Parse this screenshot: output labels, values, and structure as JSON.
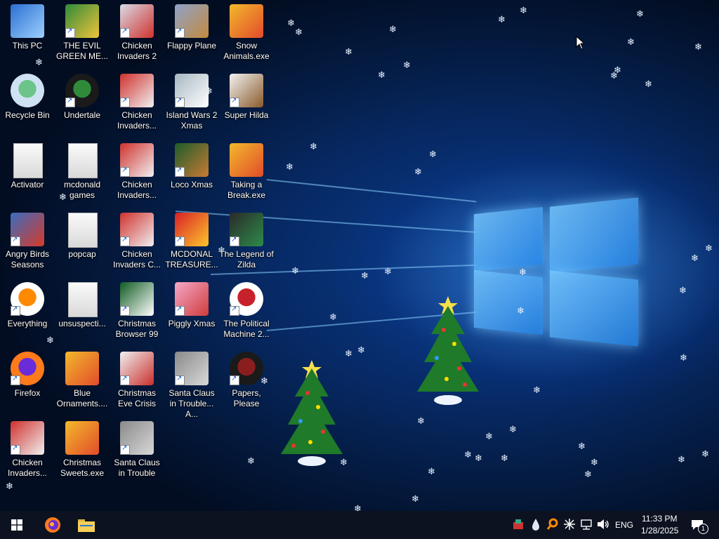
{
  "desktop": {
    "icons": [
      {
        "label": "This PC",
        "icon": "this-pc-icon",
        "shortcut": false
      },
      {
        "label": "THE EVIL GREEN ME...",
        "icon": "evil-green-men-icon",
        "shortcut": true
      },
      {
        "label": "Chicken Invaders 2",
        "icon": "chicken-invaders-2-icon",
        "shortcut": true
      },
      {
        "label": "Flappy Plane",
        "icon": "flappy-plane-icon",
        "shortcut": true
      },
      {
        "label": "Snow Animals.exe",
        "icon": "gift-box-icon",
        "shortcut": false
      },
      {
        "label": "Recycle Bin",
        "icon": "recycle-bin-icon",
        "shortcut": false
      },
      {
        "label": "Undertale",
        "icon": "undertale-icon",
        "shortcut": true
      },
      {
        "label": "Chicken Invaders...",
        "icon": "chicken-invaders-icon",
        "shortcut": true
      },
      {
        "label": "Island Wars 2 Xmas",
        "icon": "island-wars-icon",
        "shortcut": true
      },
      {
        "label": "Super Hilda",
        "icon": "super-hilda-icon",
        "shortcut": true
      },
      {
        "label": "Activator",
        "icon": "folder-icon",
        "shortcut": false
      },
      {
        "label": "mcdonald games",
        "icon": "folder-icon",
        "shortcut": false
      },
      {
        "label": "Chicken Invaders...",
        "icon": "chicken-invaders-icon",
        "shortcut": true
      },
      {
        "label": "Loco Xmas",
        "icon": "loco-xmas-icon",
        "shortcut": true
      },
      {
        "label": "Taking a Break.exe",
        "icon": "gift-box-icon",
        "shortcut": false
      },
      {
        "label": "Angry Birds Seasons",
        "icon": "angry-birds-icon",
        "shortcut": true
      },
      {
        "label": "popcap",
        "icon": "folder-icon",
        "shortcut": false
      },
      {
        "label": "Chicken Invaders C...",
        "icon": "chicken-invaders-icon",
        "shortcut": true
      },
      {
        "label": "MCDONAL TREASURE...",
        "icon": "mcdonalds-icon",
        "shortcut": true
      },
      {
        "label": "The Legend of Zilda",
        "icon": "legend-of-zilda-icon",
        "shortcut": true
      },
      {
        "label": "Everything",
        "icon": "everything-search-icon",
        "shortcut": true
      },
      {
        "label": "unsuspecti...",
        "icon": "folder-icon",
        "shortcut": false
      },
      {
        "label": "Christmas Browser 99",
        "icon": "christmas-browser-icon",
        "shortcut": true
      },
      {
        "label": "Piggly Xmas",
        "icon": "piggly-xmas-icon",
        "shortcut": true
      },
      {
        "label": "The Political Machine 2...",
        "icon": "political-machine-icon",
        "shortcut": true
      },
      {
        "label": "Firefox",
        "icon": "firefox-icon",
        "shortcut": true
      },
      {
        "label": "Blue Ornaments....",
        "icon": "gift-box-icon",
        "shortcut": false
      },
      {
        "label": "Christmas Eve Crisis",
        "icon": "santa-icon",
        "shortcut": true
      },
      {
        "label": "Santa Claus in Trouble... A...",
        "icon": "santa-claus-icon",
        "shortcut": true
      },
      {
        "label": "Papers, Please",
        "icon": "papers-please-icon",
        "shortcut": true
      },
      {
        "label": "Chicken Invaders...",
        "icon": "chicken-invaders-icon",
        "shortcut": true
      },
      {
        "label": "Christmas Sweets.exe",
        "icon": "gift-box-icon",
        "shortcut": false
      },
      {
        "label": "Santa Claus in Trouble",
        "icon": "santa-claus-icon",
        "shortcut": true
      }
    ]
  },
  "taskbar": {
    "start_icon": "windows-start-icon",
    "pinned": [
      {
        "name": "firefox",
        "icon": "firefox-icon"
      },
      {
        "name": "file-explorer",
        "icon": "folder-icon"
      }
    ],
    "tray": {
      "language": "ENG",
      "time": "11:33 PM",
      "date": "1/28/2025",
      "notification_count": "1"
    }
  },
  "colors": {
    "taskbar_bg": "#0c1220",
    "wallpaper_accent": "#3aa0ff"
  }
}
